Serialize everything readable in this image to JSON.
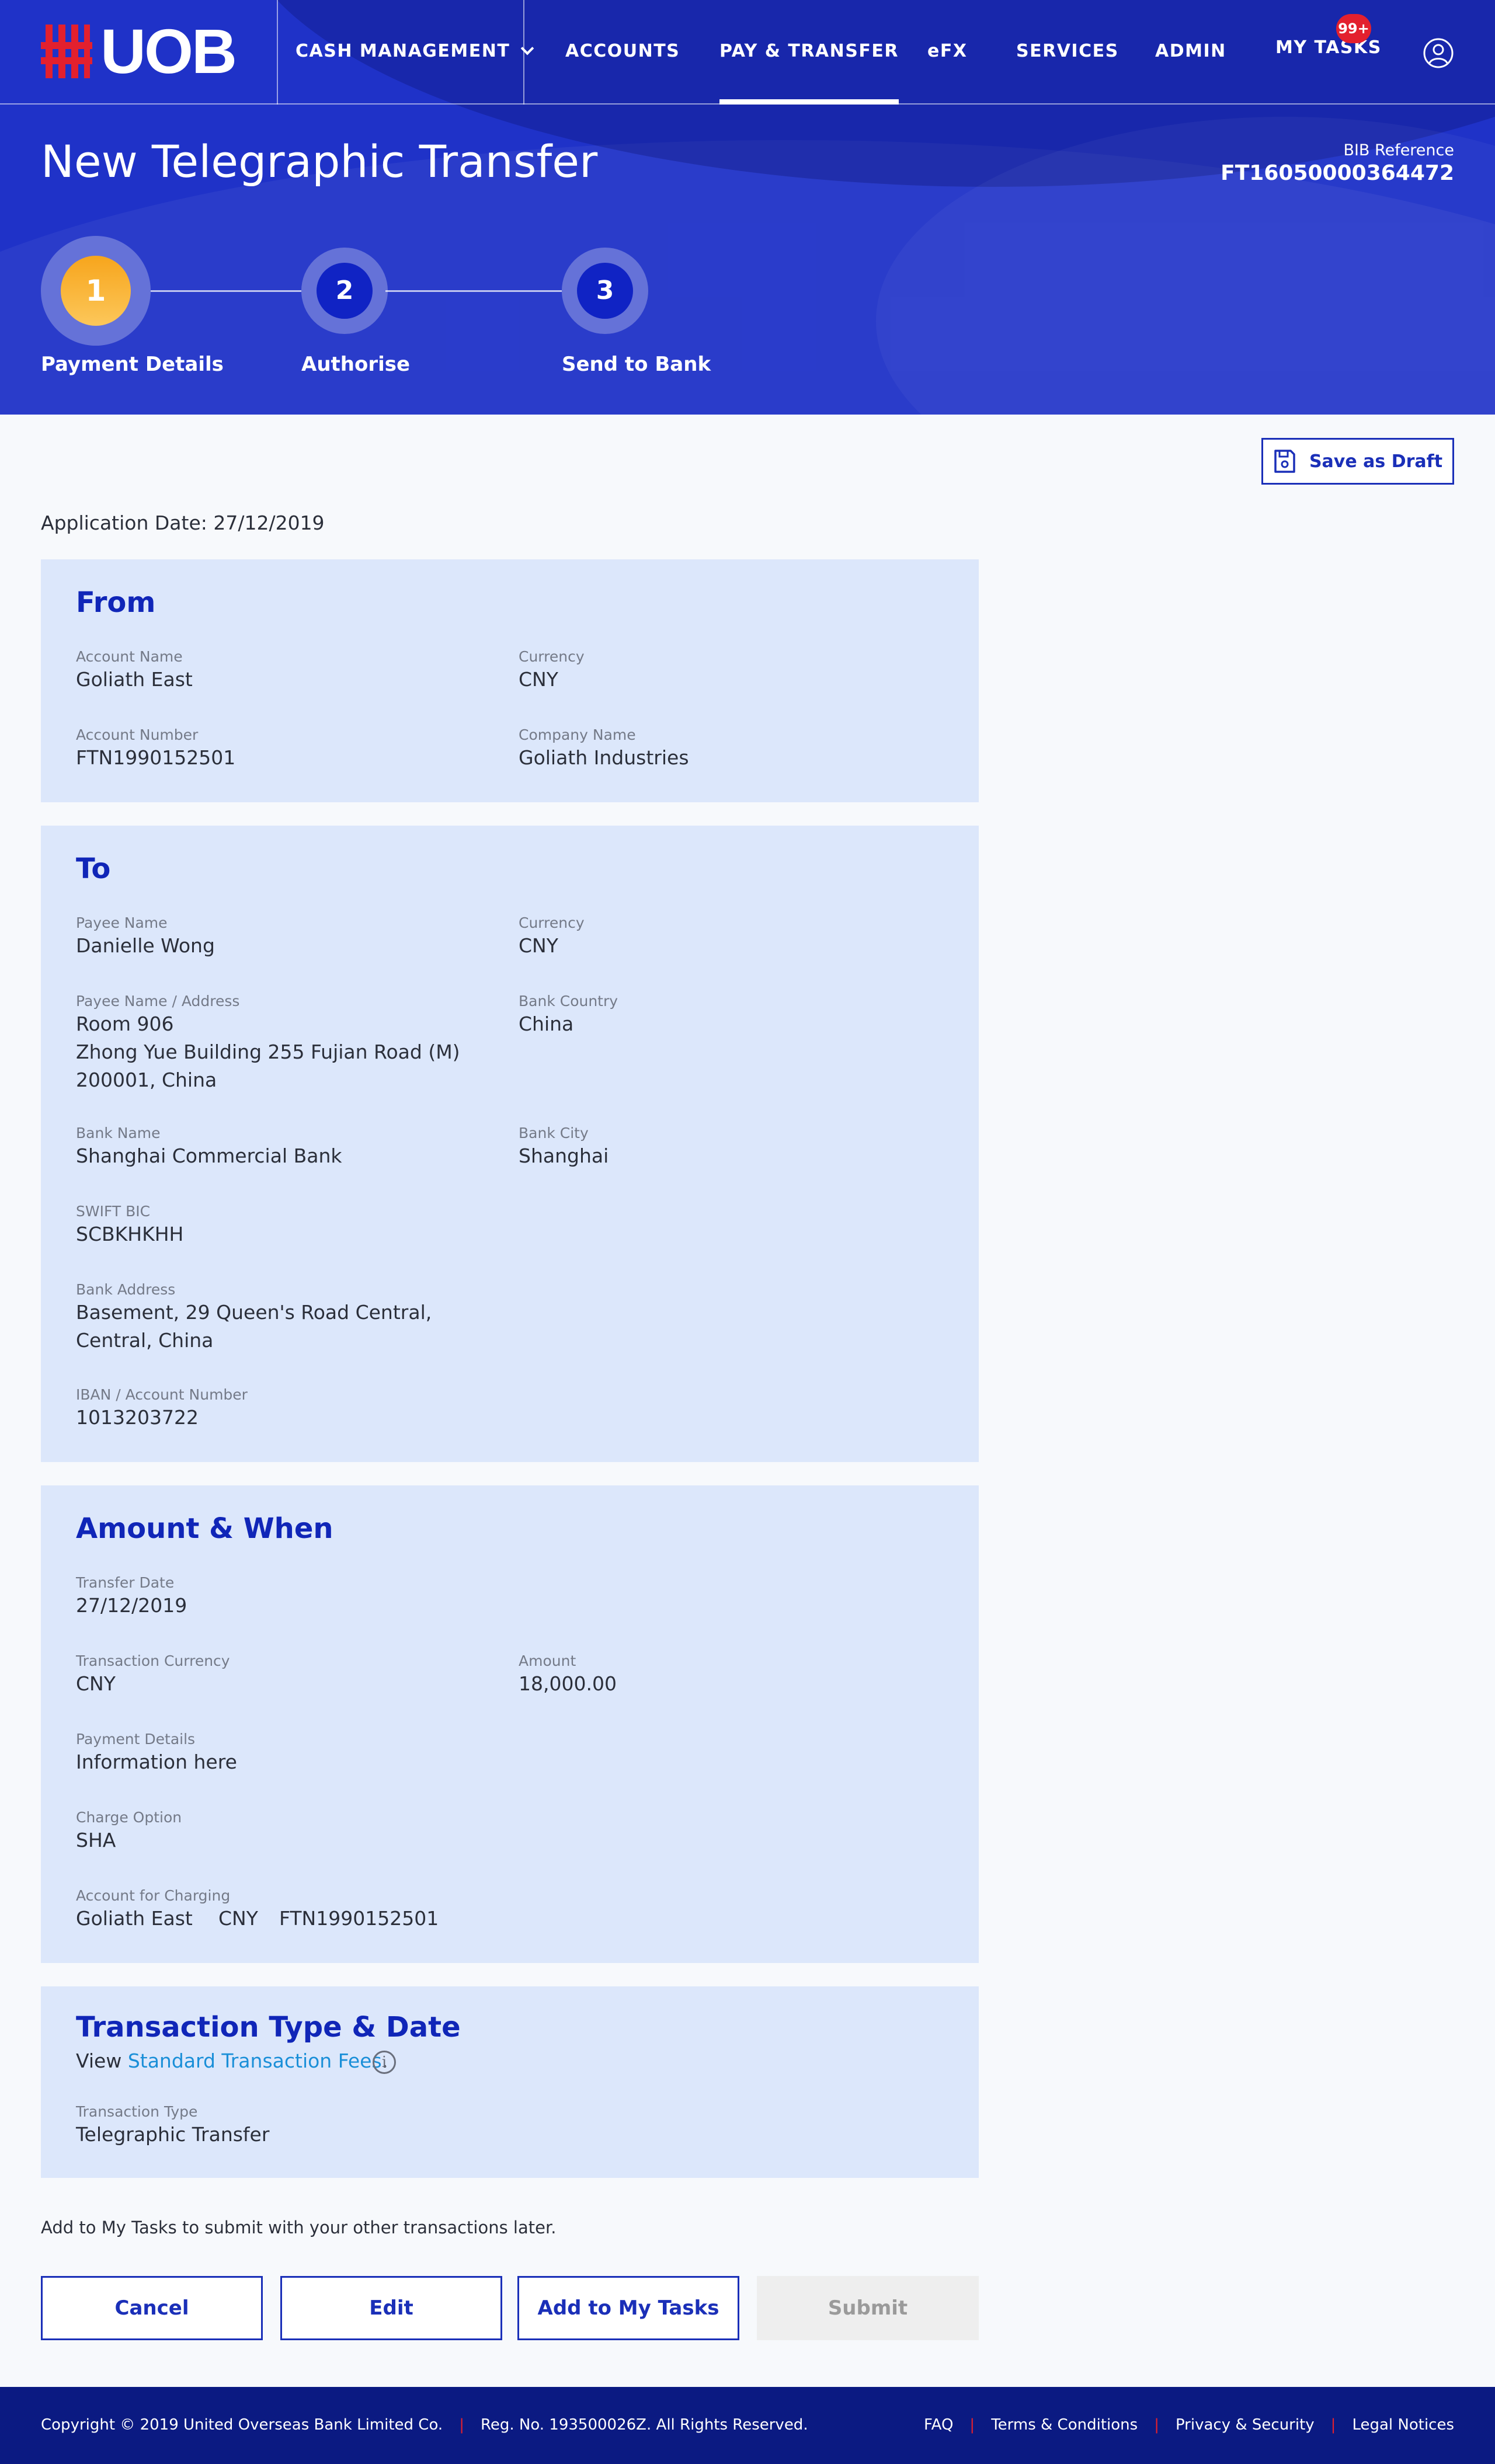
{
  "brand": {
    "name": "UOB",
    "accent": "#e3202e",
    "primary": "#1f32c8"
  },
  "nav": {
    "cash_management": "CASH MANAGEMENT",
    "accounts": "ACCOUNTS",
    "pay_transfer": "PAY & TRANSFER",
    "efx": "eFX",
    "services": "SERVICES",
    "admin": "ADMIN",
    "my_tasks": "MY TASKS",
    "tasks_badge": "99+",
    "active": "PAY & TRANSFER"
  },
  "page": {
    "title": "New Telegraphic Transfer",
    "bib_label": "BIB Reference",
    "bib_value": "FT16050000364472"
  },
  "steps": [
    {
      "number": "1",
      "label": "Payment Details",
      "state": "current"
    },
    {
      "number": "2",
      "label": "Authorise",
      "state": "pending"
    },
    {
      "number": "3",
      "label": "Send to Bank",
      "state": "pending"
    }
  ],
  "toolbar": {
    "save_draft": "Save as Draft"
  },
  "application_date": "Application Date: 27/12/2019",
  "from": {
    "title": "From",
    "account_name_label": "Account Name",
    "account_name": "Goliath East",
    "currency_label": "Currency",
    "currency": "CNY",
    "account_number_label": "Account Number",
    "account_number": "FTN1990152501",
    "company_name_label": "Company Name",
    "company_name": "Goliath Industries"
  },
  "to": {
    "title": "To",
    "payee_name_label": "Payee Name",
    "payee_name": "Danielle Wong",
    "currency_label": "Currency",
    "currency": "CNY",
    "payee_address_label": "Payee Name / Address",
    "payee_address_line1": "Room 906",
    "payee_address_line2": "Zhong Yue Building 255 Fujian Road (M)",
    "payee_address_line3": "200001, China",
    "bank_country_label": "Bank Country",
    "bank_country": "China",
    "bank_name_label": "Bank Name",
    "bank_name": "Shanghai Commercial Bank",
    "bank_city_label": "Bank City",
    "bank_city": "Shanghai",
    "swift_label": "SWIFT BIC",
    "swift": "SCBKHKHH",
    "bank_address_label": "Bank Address",
    "bank_address_line1": "Basement, 29 Queen's Road Central,",
    "bank_address_line2": "Central, China",
    "iban_label": "IBAN / Account Number",
    "iban": "1013203722"
  },
  "amount": {
    "title": "Amount & When",
    "transfer_date_label": "Transfer Date",
    "transfer_date": "27/12/2019",
    "txn_currency_label": "Transaction Currency",
    "txn_currency": "CNY",
    "amount_label": "Amount",
    "amount": "18,000.00",
    "payment_details_label": "Payment Details",
    "payment_details": "Information here",
    "charge_option_label": "Charge Option",
    "charge_option": "SHA",
    "charging_account_label": "Account for Charging",
    "charging_account_name": "Goliath East",
    "charging_account_currency": "CNY",
    "charging_account_number": "FTN1990152501"
  },
  "txn_type": {
    "title": "Transaction Type & Date",
    "view_prefix": "View ",
    "fees_link": "Standard Transaction Fees",
    "view_suffix": ".",
    "type_label": "Transaction Type",
    "type_value": "Telegraphic Transfer"
  },
  "note": "Add to My Tasks to submit with your other transactions later.",
  "actions": {
    "cancel": "Cancel",
    "edit": "Edit",
    "add_to_tasks": "Add to My Tasks",
    "submit": "Submit"
  },
  "footer": {
    "copyright": "Copyright © 2019 United Overseas Bank Limited Co.",
    "reg_no": "Reg. No. 193500026Z. All Rights Reserved.",
    "faq": "FAQ",
    "terms": "Terms & Conditions",
    "privacy": "Privacy & Security",
    "legal": "Legal Notices"
  }
}
